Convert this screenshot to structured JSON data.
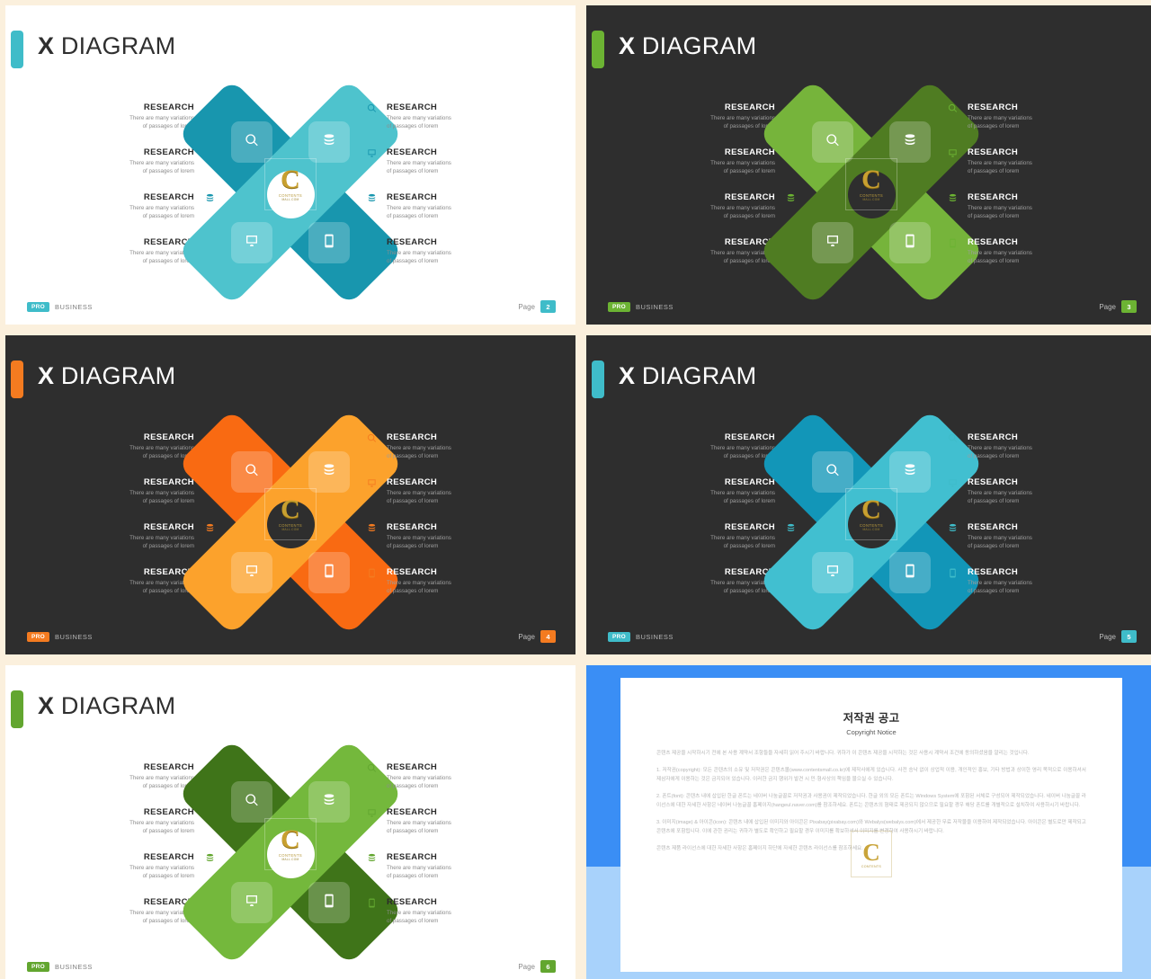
{
  "canvas": {
    "separator_color": "#fbf0dd"
  },
  "common": {
    "title_bold": "X",
    "title_rest": " DIAGRAM",
    "item_heading": "RESEARCH",
    "item_line1": "There are many variations",
    "item_line2": "of passages of lorem",
    "footer_pro": "PRO",
    "footer_business": "BUSINESS",
    "page_label": "Page",
    "watermark_letter": "C",
    "watermark_title": "CONTENTS",
    "watermark_sub": "MALL.COM",
    "icons": [
      "search-icon",
      "monitor-icon",
      "database-icon",
      "mobile-icon"
    ]
  },
  "slides": [
    {
      "id": "slide-x-diagram-teal-light",
      "theme": "light",
      "page": "2",
      "accent": "#3fbcc9",
      "badge_color": "#3fbcc9",
      "pro_color": "#3fbcc9",
      "bar_a": "#1896ae",
      "bar_b": "#4ec3cd",
      "micro_icon_color": "#1896ae",
      "bar_a_on_top": true
    },
    {
      "id": "slide-x-diagram-green-dark",
      "theme": "dark",
      "page": "3",
      "accent": "#6cb333",
      "badge_color": "#6cb333",
      "pro_color": "#6cb333",
      "bar_a": "#4f7c22",
      "bar_b": "#76b43b",
      "micro_icon_color": "#6cb333",
      "bar_a_on_top": false
    },
    {
      "id": "slide-x-diagram-orange-dark",
      "theme": "dark",
      "page": "4",
      "accent": "#f47b20",
      "badge_color": "#f47b20",
      "pro_color": "#f47b20",
      "bar_a": "#fca22c",
      "bar_b": "#f96a12",
      "micro_icon_color": "#f47b20",
      "bar_a_on_top": false
    },
    {
      "id": "slide-x-diagram-blue-dark",
      "theme": "dark",
      "page": "5",
      "accent": "#3fbcc9",
      "badge_color": "#3fbcc9",
      "pro_color": "#3fbcc9",
      "bar_a": "#1296b8",
      "bar_b": "#41bfd0",
      "micro_icon_color": "#3fbcc9",
      "bar_a_on_top": true
    },
    {
      "id": "slide-x-diagram-green-light",
      "theme": "light",
      "page": "6",
      "accent": "#62a62f",
      "badge_color": "#62a62f",
      "pro_color": "#62a62f",
      "bar_a": "#3f7419",
      "bar_b": "#74b83c",
      "micro_icon_color": "#62a62f",
      "bar_a_on_top": true
    }
  ],
  "copyright": {
    "id": "slide-copyright-notice",
    "title": "저작권 공고",
    "subtitle": "Copyright Notice",
    "paragraphs": [
      "콘텐츠 제공을 시작하시기 전에 본 사용 계약서 조항들을 자세히 읽어 주시기 바랍니다. 귀하가 이 콘텐츠 제공을 시작하는 것은 사용시 계약서 조건에 동의하셨음을 알리는 것입니다.",
      "1. 저작권(copyright): 모든 콘텐츠의 소유 및 저작권은 콘텐츠몰(www.contentsmall.co.kr)에 제작사에게 있습니다. 사전 승낙 없이 상업적 이용, 개인적인 홍보, 기타 방법과 상이한 영리 목적으로 이용하셔서 제삼자에게 이용하는 것은 금지되어 있습니다. 이러한 금지 행위가 발견 시 민·형사상의 책임을 물으실 수 있습니다.",
      "2. 폰트(font): 콘텐츠 내에 삽입된 한글 폰트는 네이버 나눔글꼴로 저작권과 사용권이 제작되었습니다. 한글 외의 모든 폰트는 Windows System에 포함된 서체로 구성되어 제작되었습니다. 네이버 나눔글꼴 라이선스에 대한 자세한 사항은 네이버 나눔글꼴 홈페이지(hangeul.naver.com)를 참조하세요. 폰트는 콘텐츠의 형태로 제공되지 않으므로 필요할 경우 해당 폰트를 개별적으로 설치하여 사용하시기 바랍니다.",
      "3. 이미지(image) & 아이콘(icon): 콘텐츠 내에 삽입된 이미지와 아이콘은 Pixabay(pixabay.com)와 Webalys(webalys.com)에서 제공한 무료 저작물을 이용하여 제작되었습니다. 아이콘은 별도로만 제작되고 콘텐츠에 포함됩니다. 이에 관한 권리는 귀하가 별도로 확인하고 필요할 경우 이미지를 확보하셔서 이미지를 변경하여 사용하시기 바랍니다.",
      "콘텐츠 제품 라이선스에 대한 자세한 사항은 홈페이지 하단에 자세한 콘텐츠 라이선스를 참조하세요."
    ],
    "watermark_letter": "C",
    "watermark_title": "CONTENTS"
  }
}
